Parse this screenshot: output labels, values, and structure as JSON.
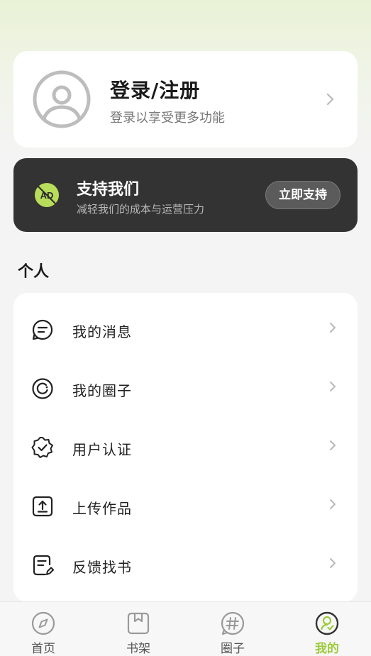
{
  "profile": {
    "title": "登录/注册",
    "subtitle": "登录以享受更多功能",
    "avatar_icon": "user-avatar-icon"
  },
  "support": {
    "icon": "ad-icon",
    "title": "支持我们",
    "subtitle": "减轻我们的成本与运营压力",
    "button_label": "立即支持",
    "accent_color": "#b7dd5a",
    "card_color": "#333333"
  },
  "section": {
    "title": "个人"
  },
  "menu": {
    "items": [
      {
        "label": "我的消息",
        "icon": "message-icon"
      },
      {
        "label": "我的圈子",
        "icon": "circle-icon"
      },
      {
        "label": "用户认证",
        "icon": "verified-badge-icon"
      },
      {
        "label": "上传作品",
        "icon": "upload-icon"
      },
      {
        "label": "反馈找书",
        "icon": "feedback-edit-icon"
      }
    ]
  },
  "tabbar": {
    "active_color": "#9ccb3c",
    "tabs": [
      {
        "label": "首页",
        "icon": "compass-icon"
      },
      {
        "label": "书架",
        "icon": "bookshelf-icon"
      },
      {
        "label": "圈子",
        "icon": "hashtag-icon"
      },
      {
        "label": "我的",
        "icon": "profile-icon",
        "active": true
      }
    ]
  }
}
